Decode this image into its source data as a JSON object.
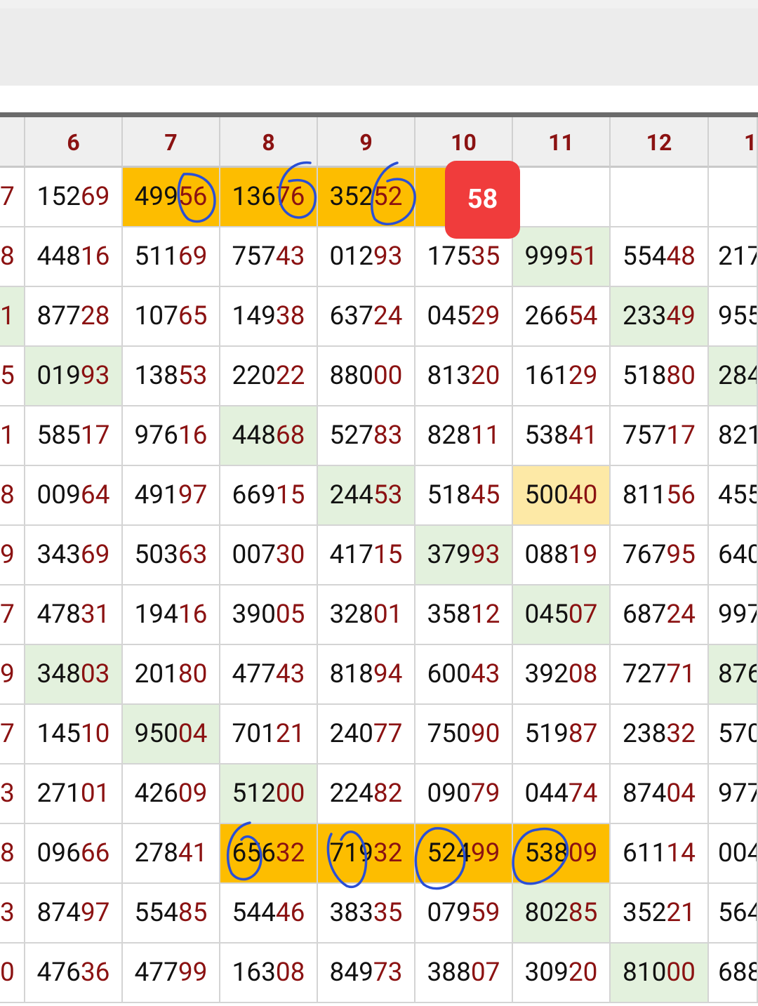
{
  "header": {
    "columns": [
      "6",
      "7",
      "8",
      "9",
      "10",
      "11",
      "12",
      "1"
    ]
  },
  "badge": {
    "value": "58"
  },
  "rows": [
    {
      "edge": "7",
      "cells": [
        {
          "a": "152",
          "b": "69",
          "bg": ""
        },
        {
          "a": "499",
          "b": "56",
          "bg": "orange"
        },
        {
          "a": "136",
          "b": "76",
          "bg": "orange"
        },
        {
          "a": "352",
          "b": "52",
          "bg": "orange"
        },
        {
          "a": "",
          "b": "",
          "bg": "orange"
        },
        {
          "a": "",
          "b": "",
          "bg": ""
        },
        {
          "a": "",
          "b": "",
          "bg": ""
        },
        {
          "a": "",
          "b": "",
          "bg": ""
        }
      ]
    },
    {
      "edge": "8",
      "cells": [
        {
          "a": "448",
          "b": "16",
          "bg": ""
        },
        {
          "a": "511",
          "b": "69",
          "bg": ""
        },
        {
          "a": "757",
          "b": "43",
          "bg": ""
        },
        {
          "a": "012",
          "b": "93",
          "bg": ""
        },
        {
          "a": "175",
          "b": "35",
          "bg": ""
        },
        {
          "a": "999",
          "b": "51",
          "bg": "green"
        },
        {
          "a": "554",
          "b": "48",
          "bg": ""
        },
        {
          "a": "217",
          "b": "",
          "bg": ""
        }
      ]
    },
    {
      "edge": "1",
      "edgeBg": "green",
      "cells": [
        {
          "a": "877",
          "b": "28",
          "bg": ""
        },
        {
          "a": "107",
          "b": "65",
          "bg": ""
        },
        {
          "a": "149",
          "b": "38",
          "bg": ""
        },
        {
          "a": "637",
          "b": "24",
          "bg": ""
        },
        {
          "a": "045",
          "b": "29",
          "bg": ""
        },
        {
          "a": "266",
          "b": "54",
          "bg": ""
        },
        {
          "a": "233",
          "b": "49",
          "bg": "green"
        },
        {
          "a": "955",
          "b": "",
          "bg": ""
        }
      ]
    },
    {
      "edge": "5",
      "cells": [
        {
          "a": "019",
          "b": "93",
          "bg": "green"
        },
        {
          "a": "138",
          "b": "53",
          "bg": ""
        },
        {
          "a": "220",
          "b": "22",
          "bg": ""
        },
        {
          "a": "880",
          "b": "00",
          "bg": ""
        },
        {
          "a": "813",
          "b": "20",
          "bg": ""
        },
        {
          "a": "161",
          "b": "29",
          "bg": ""
        },
        {
          "a": "518",
          "b": "80",
          "bg": ""
        },
        {
          "a": "284",
          "b": "",
          "bg": "green"
        }
      ]
    },
    {
      "edge": "1",
      "cells": [
        {
          "a": "585",
          "b": "17",
          "bg": ""
        },
        {
          "a": "976",
          "b": "16",
          "bg": ""
        },
        {
          "a": "448",
          "b": "68",
          "bg": "green"
        },
        {
          "a": "527",
          "b": "83",
          "bg": ""
        },
        {
          "a": "828",
          "b": "11",
          "bg": ""
        },
        {
          "a": "538",
          "b": "41",
          "bg": ""
        },
        {
          "a": "757",
          "b": "17",
          "bg": ""
        },
        {
          "a": "821",
          "b": "",
          "bg": ""
        }
      ]
    },
    {
      "edge": "8",
      "cells": [
        {
          "a": "009",
          "b": "64",
          "bg": ""
        },
        {
          "a": "491",
          "b": "97",
          "bg": ""
        },
        {
          "a": "669",
          "b": "15",
          "bg": ""
        },
        {
          "a": "244",
          "b": "53",
          "bg": "green"
        },
        {
          "a": "518",
          "b": "45",
          "bg": ""
        },
        {
          "a": "500",
          "b": "40",
          "bg": "cream"
        },
        {
          "a": "811",
          "b": "56",
          "bg": ""
        },
        {
          "a": "455",
          "b": "",
          "bg": ""
        }
      ]
    },
    {
      "edge": "9",
      "cells": [
        {
          "a": "343",
          "b": "69",
          "bg": ""
        },
        {
          "a": "503",
          "b": "63",
          "bg": ""
        },
        {
          "a": "007",
          "b": "30",
          "bg": ""
        },
        {
          "a": "417",
          "b": "15",
          "bg": ""
        },
        {
          "a": "379",
          "b": "93",
          "bg": "green"
        },
        {
          "a": "088",
          "b": "19",
          "bg": ""
        },
        {
          "a": "767",
          "b": "95",
          "bg": ""
        },
        {
          "a": "640",
          "b": "",
          "bg": ""
        }
      ]
    },
    {
      "edge": "7",
      "cells": [
        {
          "a": "478",
          "b": "31",
          "bg": ""
        },
        {
          "a": "194",
          "b": "16",
          "bg": ""
        },
        {
          "a": "390",
          "b": "05",
          "bg": ""
        },
        {
          "a": "328",
          "b": "01",
          "bg": ""
        },
        {
          "a": "358",
          "b": "12",
          "bg": ""
        },
        {
          "a": "045",
          "b": "07",
          "bg": "green"
        },
        {
          "a": "687",
          "b": "24",
          "bg": ""
        },
        {
          "a": "997",
          "b": "",
          "bg": ""
        }
      ]
    },
    {
      "edge": "9",
      "cells": [
        {
          "a": "348",
          "b": "03",
          "bg": "green"
        },
        {
          "a": "201",
          "b": "80",
          "bg": ""
        },
        {
          "a": "477",
          "b": "43",
          "bg": ""
        },
        {
          "a": "818",
          "b": "94",
          "bg": ""
        },
        {
          "a": "600",
          "b": "43",
          "bg": ""
        },
        {
          "a": "392",
          "b": "08",
          "bg": ""
        },
        {
          "a": "727",
          "b": "71",
          "bg": ""
        },
        {
          "a": "876",
          "b": "",
          "bg": "green"
        }
      ]
    },
    {
      "edge": "7",
      "cells": [
        {
          "a": "145",
          "b": "10",
          "bg": ""
        },
        {
          "a": "950",
          "b": "04",
          "bg": "green"
        },
        {
          "a": "701",
          "b": "21",
          "bg": ""
        },
        {
          "a": "240",
          "b": "77",
          "bg": ""
        },
        {
          "a": "750",
          "b": "90",
          "bg": ""
        },
        {
          "a": "519",
          "b": "87",
          "bg": ""
        },
        {
          "a": "238",
          "b": "32",
          "bg": ""
        },
        {
          "a": "570",
          "b": "",
          "bg": ""
        }
      ]
    },
    {
      "edge": "3",
      "cells": [
        {
          "a": "271",
          "b": "01",
          "bg": ""
        },
        {
          "a": "426",
          "b": "09",
          "bg": ""
        },
        {
          "a": "512",
          "b": "00",
          "bg": "green"
        },
        {
          "a": "224",
          "b": "82",
          "bg": ""
        },
        {
          "a": "090",
          "b": "79",
          "bg": ""
        },
        {
          "a": "044",
          "b": "74",
          "bg": ""
        },
        {
          "a": "874",
          "b": "04",
          "bg": ""
        },
        {
          "a": "977",
          "b": "",
          "bg": ""
        }
      ]
    },
    {
      "edge": "8",
      "cells": [
        {
          "a": "096",
          "b": "66",
          "bg": ""
        },
        {
          "a": "278",
          "b": "41",
          "bg": ""
        },
        {
          "a": "656",
          "b": "32",
          "bg": "orange"
        },
        {
          "a": "719",
          "b": "32",
          "bg": "orange"
        },
        {
          "a": "524",
          "b": "99",
          "bg": "orange"
        },
        {
          "a": "538",
          "b": "09",
          "bg": "orange"
        },
        {
          "a": "611",
          "b": "14",
          "bg": ""
        },
        {
          "a": "004",
          "b": "",
          "bg": ""
        }
      ]
    },
    {
      "edge": "3",
      "cells": [
        {
          "a": "874",
          "b": "97",
          "bg": ""
        },
        {
          "a": "554",
          "b": "85",
          "bg": ""
        },
        {
          "a": "544",
          "b": "46",
          "bg": ""
        },
        {
          "a": "383",
          "b": "35",
          "bg": ""
        },
        {
          "a": "079",
          "b": "59",
          "bg": ""
        },
        {
          "a": "802",
          "b": "85",
          "bg": "green"
        },
        {
          "a": "352",
          "b": "21",
          "bg": ""
        },
        {
          "a": "564",
          "b": "",
          "bg": ""
        }
      ]
    },
    {
      "edge": "0",
      "cells": [
        {
          "a": "476",
          "b": "36",
          "bg": ""
        },
        {
          "a": "477",
          "b": "99",
          "bg": ""
        },
        {
          "a": "163",
          "b": "08",
          "bg": ""
        },
        {
          "a": "849",
          "b": "73",
          "bg": ""
        },
        {
          "a": "388",
          "b": "07",
          "bg": ""
        },
        {
          "a": "309",
          "b": "20",
          "bg": ""
        },
        {
          "a": "810",
          "b": "00",
          "bg": "green"
        },
        {
          "a": "688",
          "b": "",
          "bg": ""
        }
      ]
    }
  ]
}
